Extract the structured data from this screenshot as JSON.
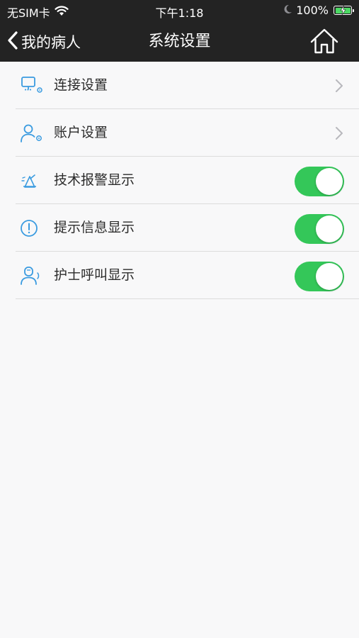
{
  "status_bar": {
    "carrier": "无SIM卡",
    "time": "下午1:18",
    "battery_percent": "100%",
    "wifi_icon": "wifi-icon",
    "moon_icon": "do-not-disturb-moon-icon",
    "battery_icon": "battery-charging-icon"
  },
  "nav": {
    "back_label": "我的病人",
    "title": "系统设置",
    "home_icon": "home-icon"
  },
  "settings": {
    "items": [
      {
        "label": "连接设置",
        "icon": "monitor-settings-icon",
        "type": "link"
      },
      {
        "label": "账户设置",
        "icon": "user-settings-icon",
        "type": "link"
      },
      {
        "label": "技术报警显示",
        "icon": "technical-alarm-icon",
        "type": "toggle",
        "on": true
      },
      {
        "label": "提示信息显示",
        "icon": "info-exclamation-icon",
        "type": "toggle",
        "on": true
      },
      {
        "label": "护士呼叫显示",
        "icon": "nurse-call-icon",
        "type": "toggle",
        "on": true
      }
    ]
  },
  "colors": {
    "bar_background": "#232323",
    "page_background": "#f8f8f9",
    "icon_blue": "#3a9be0",
    "toggle_on": "#34c759",
    "divider": "#dcdcdc"
  }
}
